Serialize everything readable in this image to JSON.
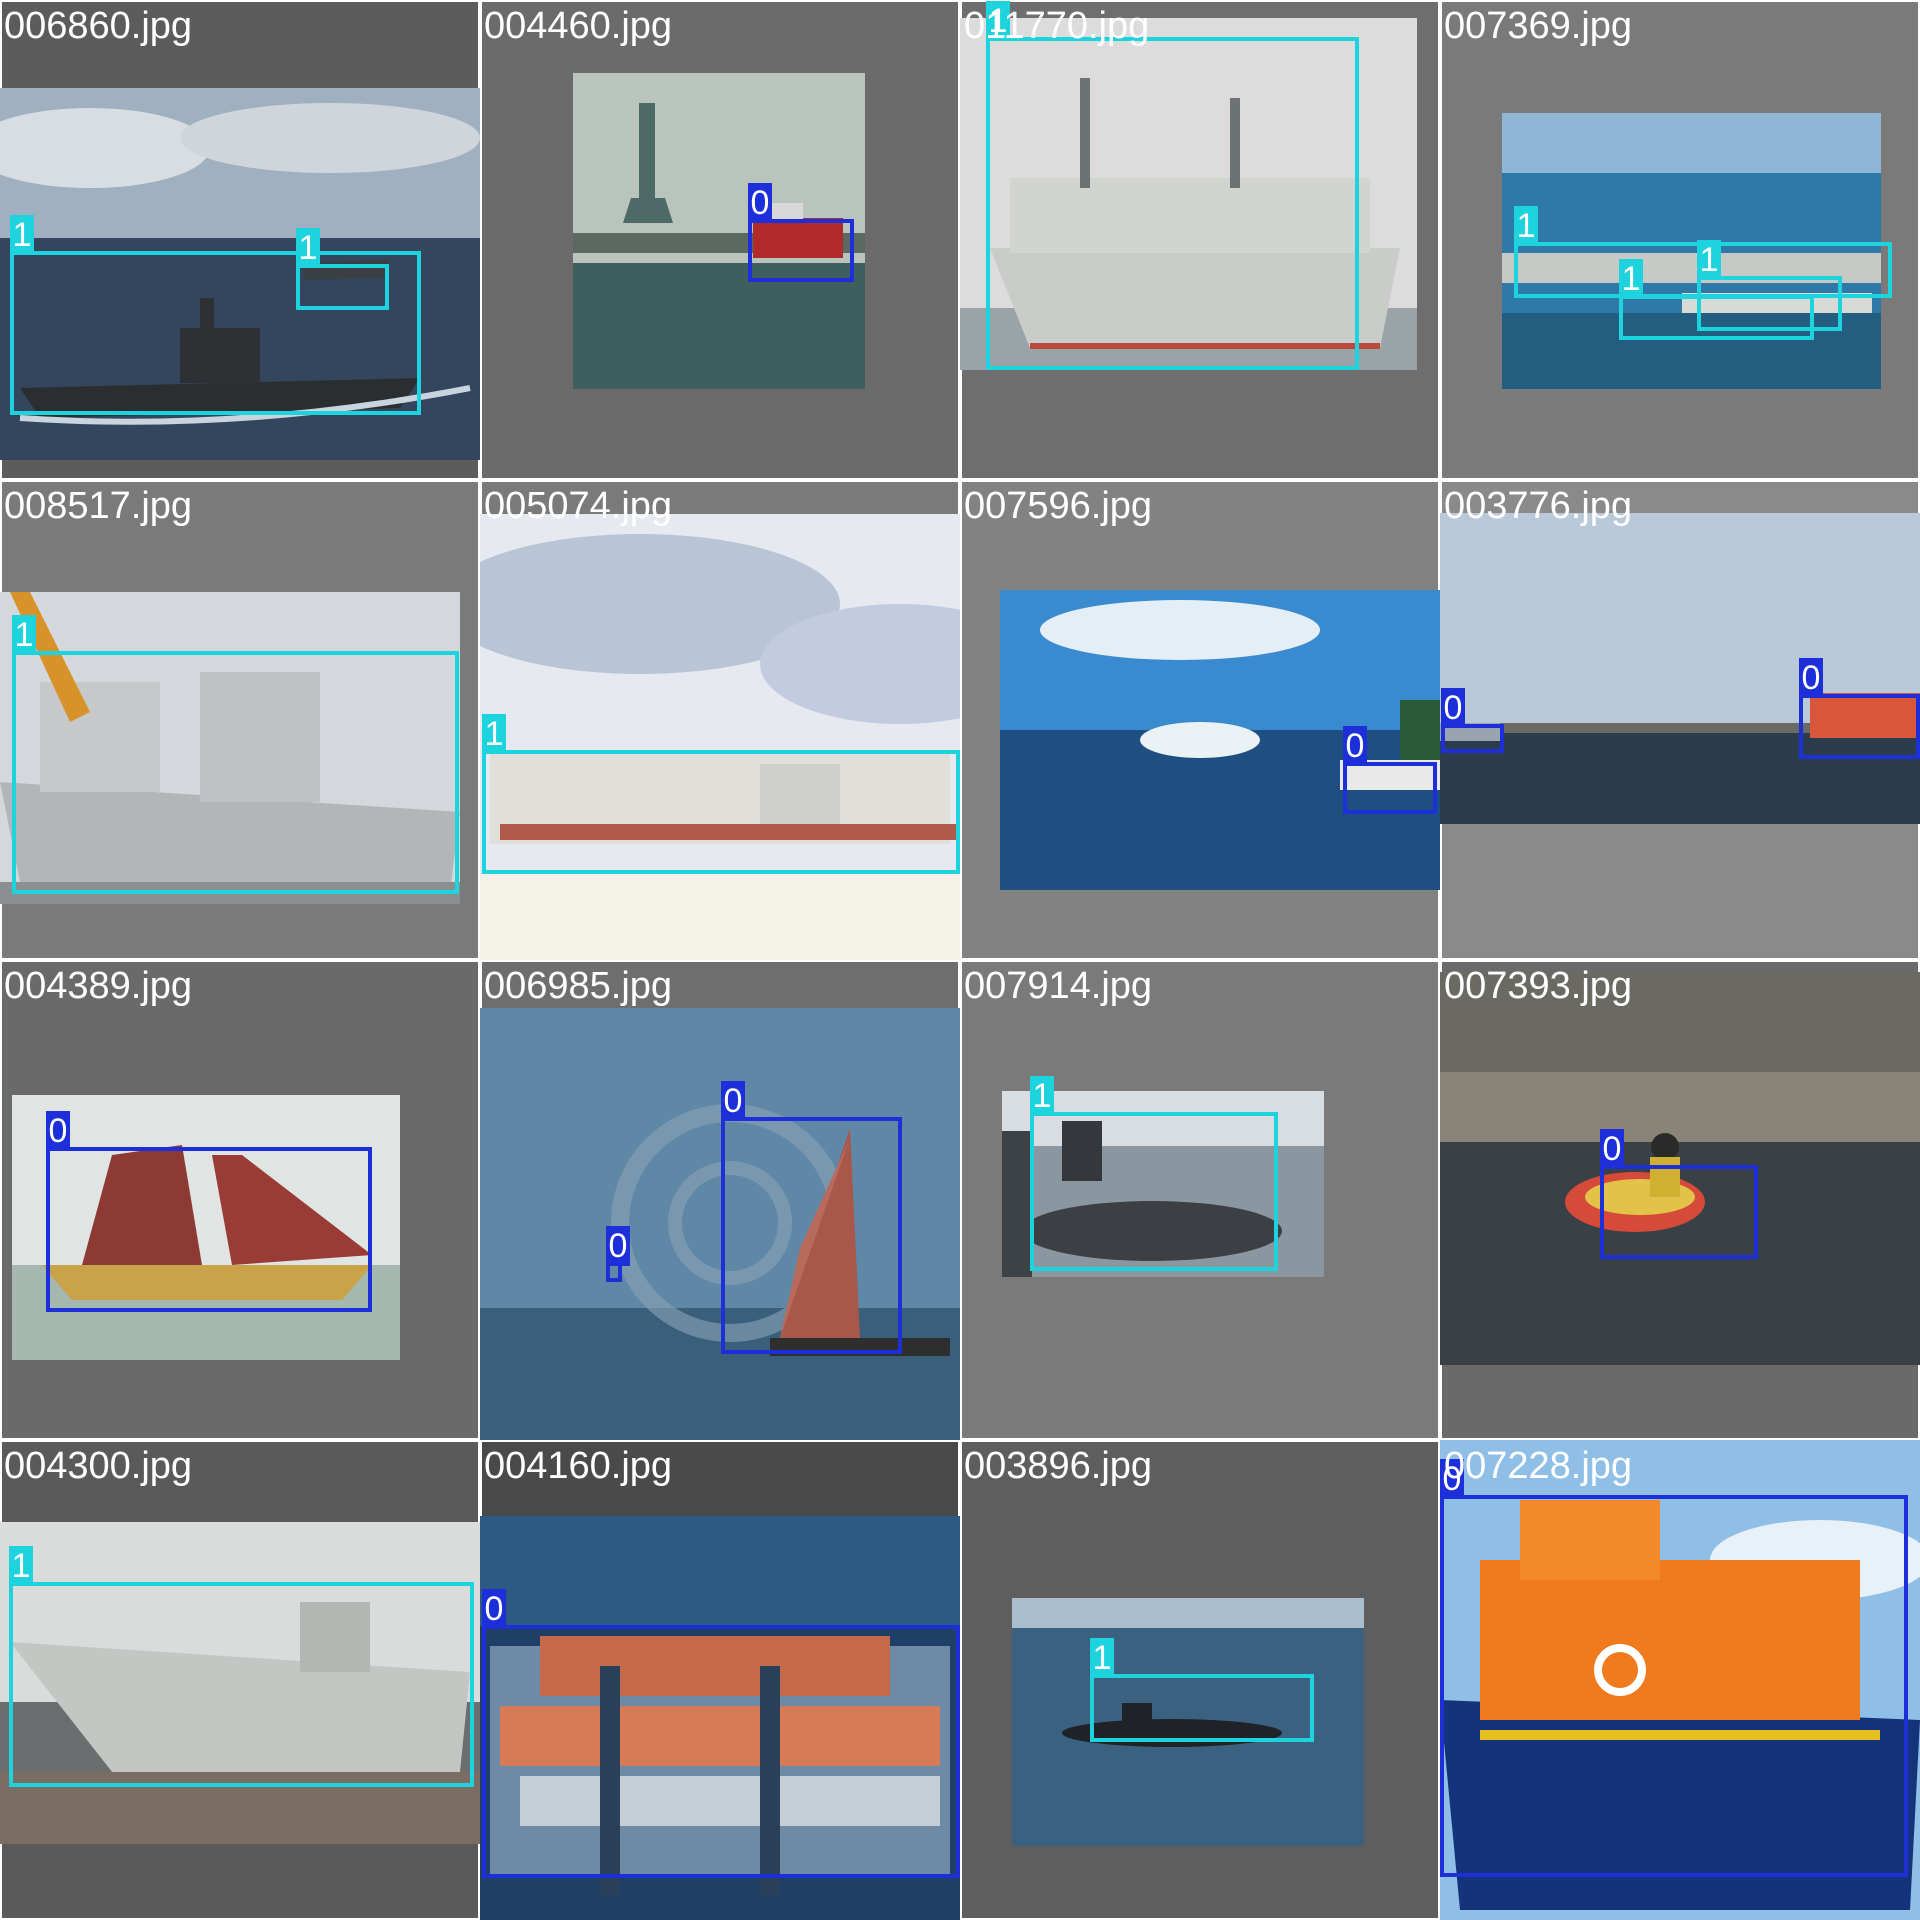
{
  "classes": [
    {
      "id": "0",
      "color": "#1c2fd8"
    },
    {
      "id": "1",
      "color": "#1dd3dd"
    }
  ],
  "tiles": [
    {
      "caption": "006860.jpg",
      "tile_bg": "#5c5c5c",
      "scene": "destroyer-at-sea",
      "boxes": [
        {
          "label": "1"
        },
        {
          "label": "1"
        }
      ]
    },
    {
      "caption": "004460.jpg",
      "tile_bg": "#6b6b6b",
      "scene": "harbor-statue-fireboat",
      "boxes": [
        {
          "label": "0"
        }
      ]
    },
    {
      "caption": "011770.jpg",
      "tile_bg": "#6e6e6e",
      "scene": "supply-ship",
      "boxes": [
        {
          "label": "1"
        }
      ]
    },
    {
      "caption": "007369.jpg",
      "tile_bg": "#7a7a7a",
      "scene": "carrier-in-harbor",
      "boxes": [
        {
          "label": "1"
        },
        {
          "label": "1"
        },
        {
          "label": "1"
        }
      ]
    },
    {
      "caption": "008517.jpg",
      "tile_bg": "#7a7a7a",
      "scene": "frigates-at-pier",
      "boxes": [
        {
          "label": "1"
        }
      ]
    },
    {
      "caption": "005074.jpg",
      "tile_bg": "#7a7a7a",
      "scene": "hovercraft",
      "boxes": [
        {
          "label": "1"
        }
      ]
    },
    {
      "caption": "007596.jpg",
      "tile_bg": "#828282",
      "scene": "blue-bay-boat",
      "boxes": [
        {
          "label": "0"
        }
      ]
    },
    {
      "caption": "003776.jpg",
      "tile_bg": "#8a8a8a",
      "scene": "calm-harbor-lifeboat",
      "boxes": [
        {
          "label": "0"
        },
        {
          "label": "0"
        }
      ]
    },
    {
      "caption": "004389.jpg",
      "tile_bg": "#6a6a6a",
      "scene": "red-sail-boat",
      "boxes": [
        {
          "label": "0"
        }
      ]
    },
    {
      "caption": "006985.jpg",
      "tile_bg": "#6e6e6e",
      "scene": "sailboat-open-sea",
      "boxes": [
        {
          "label": "0"
        },
        {
          "label": "0"
        }
      ]
    },
    {
      "caption": "007914.jpg",
      "tile_bg": "#7a7a7a",
      "scene": "submarine-at-pier",
      "boxes": [
        {
          "label": "1"
        }
      ]
    },
    {
      "caption": "007393.jpg",
      "tile_bg": "#6a6a6a",
      "scene": "kayaker",
      "boxes": [
        {
          "label": "0"
        }
      ]
    },
    {
      "caption": "004300.jpg",
      "tile_bg": "#5a5a5a",
      "scene": "frigate-175",
      "boxes": [
        {
          "label": "1"
        }
      ]
    },
    {
      "caption": "004160.jpg",
      "tile_bg": "#4a4a4a",
      "scene": "container-ship",
      "boxes": [
        {
          "label": "0"
        }
      ]
    },
    {
      "caption": "003896.jpg",
      "tile_bg": "#5e5e5e",
      "scene": "submarine-surfaced",
      "boxes": [
        {
          "label": "1"
        }
      ]
    },
    {
      "caption": "007228.jpg",
      "tile_bg": "#7a7a7a",
      "scene": "orange-lifeboat",
      "boxes": [
        {
          "label": "0"
        }
      ]
    }
  ]
}
